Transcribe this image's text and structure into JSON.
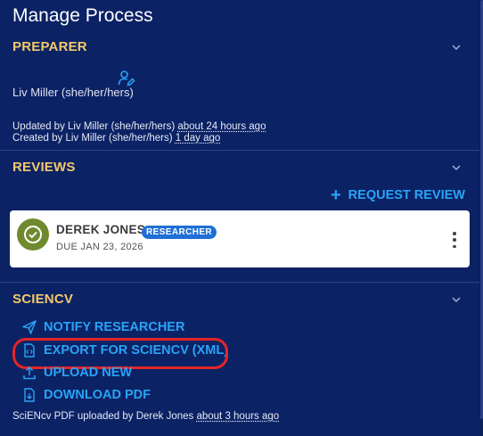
{
  "title": "Manage Process",
  "preparer": {
    "heading": "PREPARER",
    "name": "Liv Miller (she/her/hers)",
    "updated_prefix": "Updated by Liv Miller (she/her/hers) ",
    "updated_time": "about 24 hours ago",
    "created_prefix": "Created by Liv Miller (she/her/hers) ",
    "created_time": "1 day ago"
  },
  "reviews": {
    "heading": "REVIEWS",
    "request_label": "REQUEST REVIEW",
    "card": {
      "name": "DEREK JONES",
      "role_badge": "RESEARCHER",
      "due": "DUE JAN 23, 2026"
    }
  },
  "sciencv": {
    "heading": "SCIENCV",
    "actions": [
      {
        "label": "NOTIFY RESEARCHER",
        "icon": "send-icon"
      },
      {
        "label": "EXPORT FOR SCIENCV (XML)",
        "icon": "code-file-icon"
      },
      {
        "label": "UPLOAD NEW",
        "icon": "upload-icon"
      },
      {
        "label": "DOWNLOAD PDF",
        "icon": "download-file-icon"
      }
    ],
    "footer_prefix": "SciENcv PDF uploaded by Derek Jones ",
    "footer_time": "about 3 hours ago"
  },
  "colors": {
    "background": "#0b2265",
    "section_heading": "#f3c969",
    "action_blue": "#2aa3f5",
    "badge_blue": "#1f6fd6",
    "avatar_green": "#6f8a2e",
    "highlight_red": "#e32626"
  }
}
